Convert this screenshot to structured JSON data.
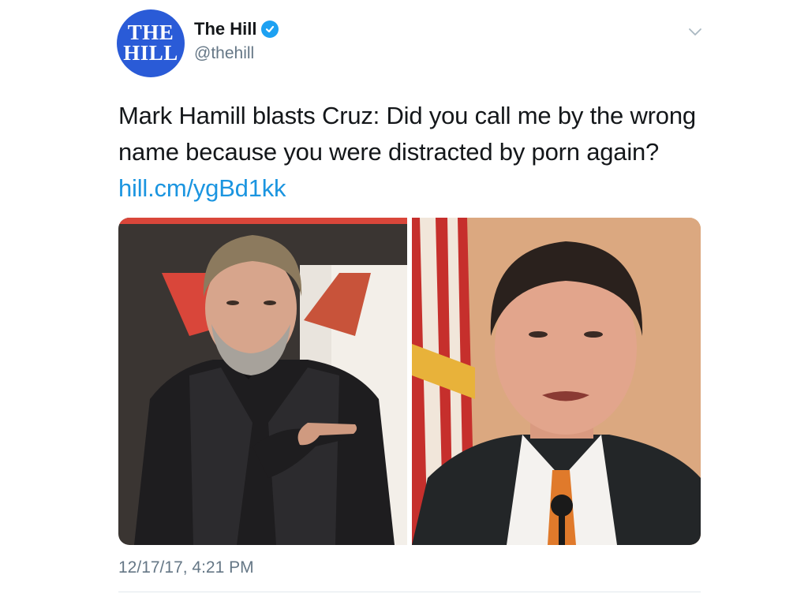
{
  "author": {
    "avatar_line1": "THE",
    "avatar_line2": "HILL",
    "display_name": "The Hill",
    "handle": "@thehill",
    "verified": true
  },
  "tweet": {
    "text": "Mark Hamill blasts Cruz: Did you call me by the wrong name because you were distracted by porn again?",
    "link": "hill.cm/ygBd1kk",
    "timestamp": "12/17/17, 4:21 PM"
  },
  "media": {
    "photos": [
      {
        "subject": "man-with-gray-beard-pointing"
      },
      {
        "subject": "man-in-suit-speaking-at-microphone"
      }
    ]
  },
  "colors": {
    "link": "#1b95e0",
    "verified_badge": "#1da1f2",
    "avatar_bg": "#2a5bd7",
    "secondary_text": "#657786"
  },
  "icons": {
    "verified": "verified-badge-icon",
    "menu": "chevron-down-icon"
  }
}
